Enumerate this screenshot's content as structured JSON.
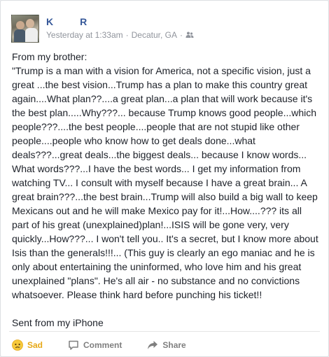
{
  "post": {
    "author_first": "K",
    "author_last": "R",
    "timestamp": "Yesterday at 1:33am",
    "separator": "·",
    "location": "Decatur, GA",
    "separator2": "·",
    "audience_icon": "friends-icon",
    "intro": "From my brother:",
    "text": "\"Trump is a man with a vision for America, not a specific vision, just a great ...the best vision...Trump has a plan to make this country great again....What plan??....a great plan...a plan that will work because it's the best plan.....Why???... because Trump knows good people...which people???....the best people....people that are not stupid like other people....people who know how to get deals done...what deals???...great deals...the biggest deals... because I know words... What words???...I have the best words... I get my information from watching TV... I consult with myself because I have a great brain... A great brain???...the best brain...Trump will also build a big wall to keep Mexicans out and he will make Mexico pay for it!...How....??? its all part of his great (unexplained)plan!...ISIS will be gone very, very quickly...How???... I won't tell you.. It's a secret, but I know more about Isis than the generals!!!... (This guy is clearly an ego maniac and he is only about entertaining the uninformed, who love him and his great unexplained \"plans\". He's all air - no substance and no convictions whatsoever. Please think hard before punching his ticket!!",
    "signature": "Sent from my iPhone"
  },
  "actions": {
    "reaction_label": "Sad",
    "reaction_icon": "sad-face-icon",
    "comment_label": "Comment",
    "comment_icon": "comment-icon",
    "share_label": "Share",
    "share_icon": "share-icon"
  },
  "colors": {
    "link": "#365899",
    "meta": "#90949c",
    "sad": "#e6a817",
    "action": "#7f7f7f"
  }
}
